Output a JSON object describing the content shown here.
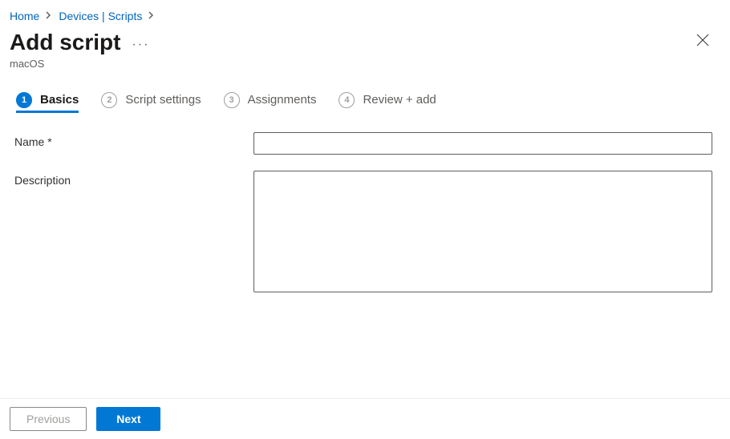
{
  "breadcrumb": {
    "items": [
      {
        "label": "Home"
      },
      {
        "label": "Devices | Scripts"
      }
    ]
  },
  "header": {
    "title": "Add script",
    "subtitle": "macOS"
  },
  "stepper": {
    "steps": [
      {
        "num": "1",
        "label": "Basics",
        "active": true
      },
      {
        "num": "2",
        "label": "Script settings",
        "active": false
      },
      {
        "num": "3",
        "label": "Assignments",
        "active": false
      },
      {
        "num": "4",
        "label": "Review + add",
        "active": false
      }
    ]
  },
  "form": {
    "name_label": "Name *",
    "name_value": "",
    "description_label": "Description",
    "description_value": ""
  },
  "footer": {
    "previous_label": "Previous",
    "next_label": "Next"
  }
}
